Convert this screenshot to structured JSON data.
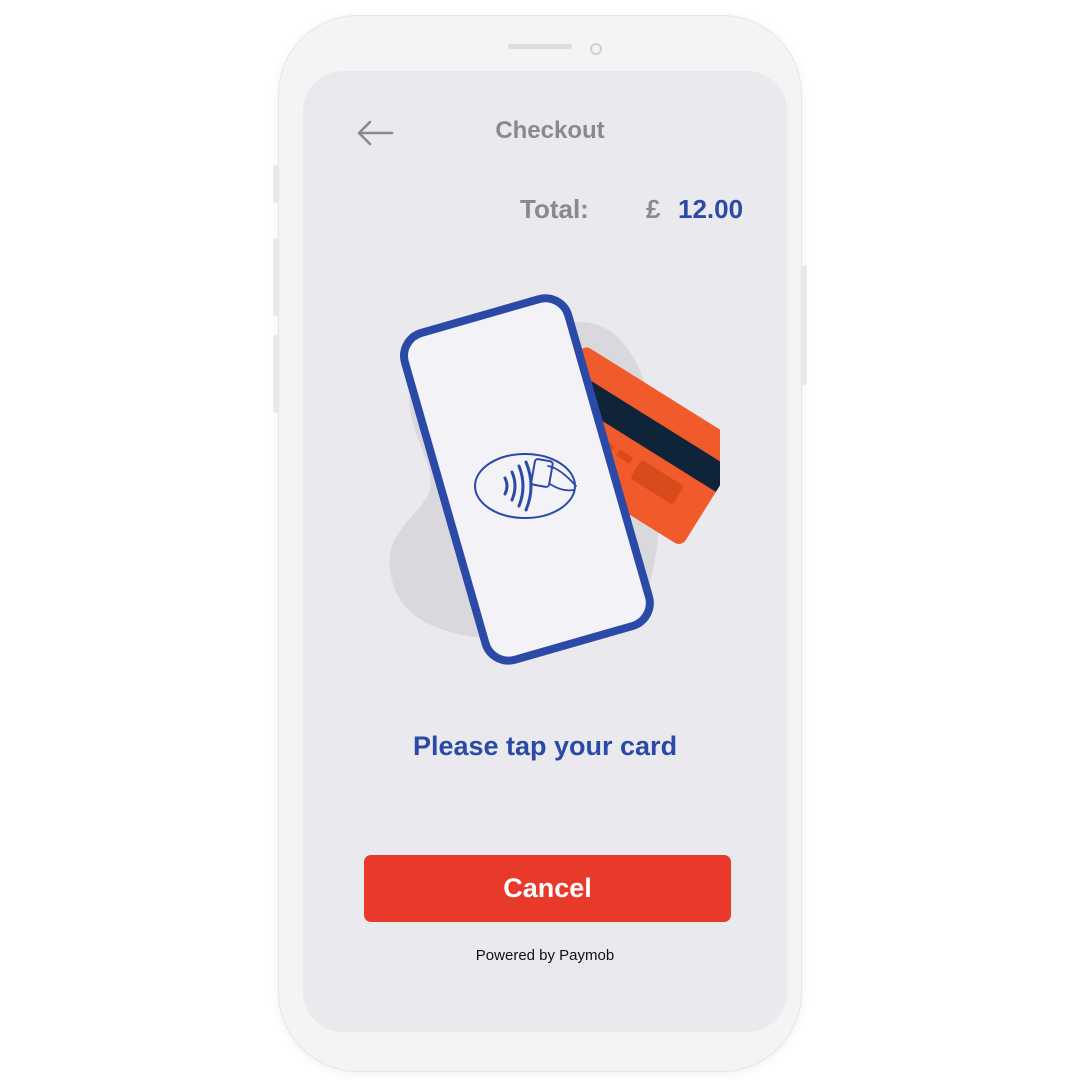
{
  "header": {
    "title": "Checkout",
    "back_icon": "arrow-left-icon"
  },
  "total": {
    "label": "Total:",
    "currency": "£",
    "amount": "12.00"
  },
  "illustration": {
    "icon": "contactless-tap-icon",
    "card_color": "#f15a2b",
    "phone_outline_color": "#2b4aa8"
  },
  "prompt": "Please tap your card",
  "actions": {
    "cancel_label": "Cancel"
  },
  "footer": {
    "powered_by": "Powered by Paymob"
  },
  "colors": {
    "accent": "#2b4aa8",
    "danger": "#e8392a",
    "muted_text": "#8a8a8e",
    "screen_bg": "#eaeaee"
  }
}
